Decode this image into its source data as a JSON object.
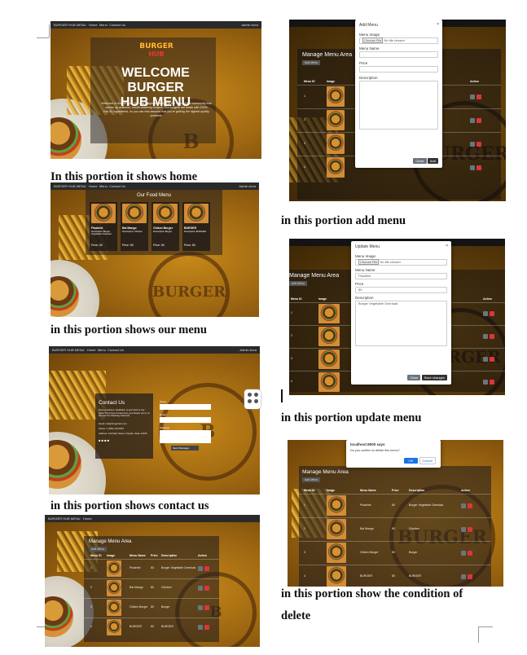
{
  "captions": {
    "home": "In this portion it shows home",
    "menu": "in this portion shows our menu",
    "contact": "in this portion shows contact us",
    "add": "in this portion add menu",
    "update": "in this portion update menu",
    "delete_line1": "in this portion show the condition of",
    "delete_line2": "delete"
  },
  "nav": {
    "brand": "BURGER HUB MENU",
    "home": "Home",
    "menu": "Menu",
    "contact": "Contact Us",
    "admin": "Admin Area"
  },
  "home": {
    "logo_top": "BURGER",
    "logo_bottom": "HUB",
    "title_line1": "WELCOME BURGER",
    "title_line2": "HUB MENU",
    "text": "Welcome to Burger Hub! We're a burger restaurant in the heart of the community that serves up delicious, mouth-watering burgers. Our burgers are made with 100% HALAL ingredients, so you can rest assured that you're getting the highest quality products."
  },
  "food_menu": {
    "title": "Our Food Menu",
    "items": [
      {
        "name": "Pisabhei",
        "desc": "Description Burger Vegetable Overload",
        "price": "Price: 80"
      },
      {
        "name": "Bai Mango",
        "desc": "Description Chicken",
        "price": "Price: 80"
      },
      {
        "name": "Chiken Burger",
        "desc": "Description Burger",
        "price": "Price: 80"
      },
      {
        "name": "BURGER",
        "desc": "Description BURGER",
        "price": "Price: 80"
      }
    ]
  },
  "contact": {
    "title": "Contact Us",
    "text": "Have questions, feedback, or just want to say hello? We'd love to hear from you! Reach out to us through the following channels:",
    "email": "Email: info@burgerhub.com",
    "phone": "Phone: 1 (555) 123-4567",
    "address": "Address: 123 Main Street, Cityville, State 12345",
    "name_label": "Name",
    "email_label": "Email",
    "message_label": "Message",
    "send": "Send Message"
  },
  "manage": {
    "title": "Manage Menu Area",
    "add_button": "Add Menu",
    "headers": [
      "Menu ID",
      "Image",
      "Menu Name",
      "Price",
      "Description",
      "Action"
    ],
    "rows": [
      {
        "id": "1",
        "name": "Pisabhei",
        "price": "80",
        "desc": "Burger Vegetable Overload"
      },
      {
        "id": "2",
        "name": "Bai Mango",
        "price": "80",
        "desc": "Chicken"
      },
      {
        "id": "3",
        "name": "Chiken Burger",
        "price": "80",
        "desc": "Burger"
      },
      {
        "id": "4",
        "name": "BURGER",
        "price": "80",
        "desc": "BURGER"
      }
    ]
  },
  "add_modal": {
    "title": "Add Menu",
    "image_label": "Menu Image",
    "choose": "Choose File",
    "nofile": "No file chosen",
    "name_label": "Menu Name",
    "price_label": "Price",
    "desc_label": "Description",
    "close": "Close",
    "add": "Add"
  },
  "update_modal": {
    "title": "Update Menu",
    "image_label": "Menu Image",
    "choose": "Choose File",
    "nofile": "No file chosen",
    "name_label": "Menu Name",
    "name_value": "Pisabhei",
    "price_label": "Price",
    "price_value": "80",
    "desc_label": "Description",
    "desc_value": "Burger Vegetable Overload",
    "close": "Close",
    "save": "Save changes"
  },
  "confirm": {
    "host": "localhost:8000 says",
    "message": "Do you confirm to delete this menu?",
    "ok": "OK",
    "cancel": "Cancel"
  },
  "colors": {
    "ok_button": "#1a73e8",
    "delete_button": "#d9363e",
    "edit_button": "#6c757d"
  }
}
